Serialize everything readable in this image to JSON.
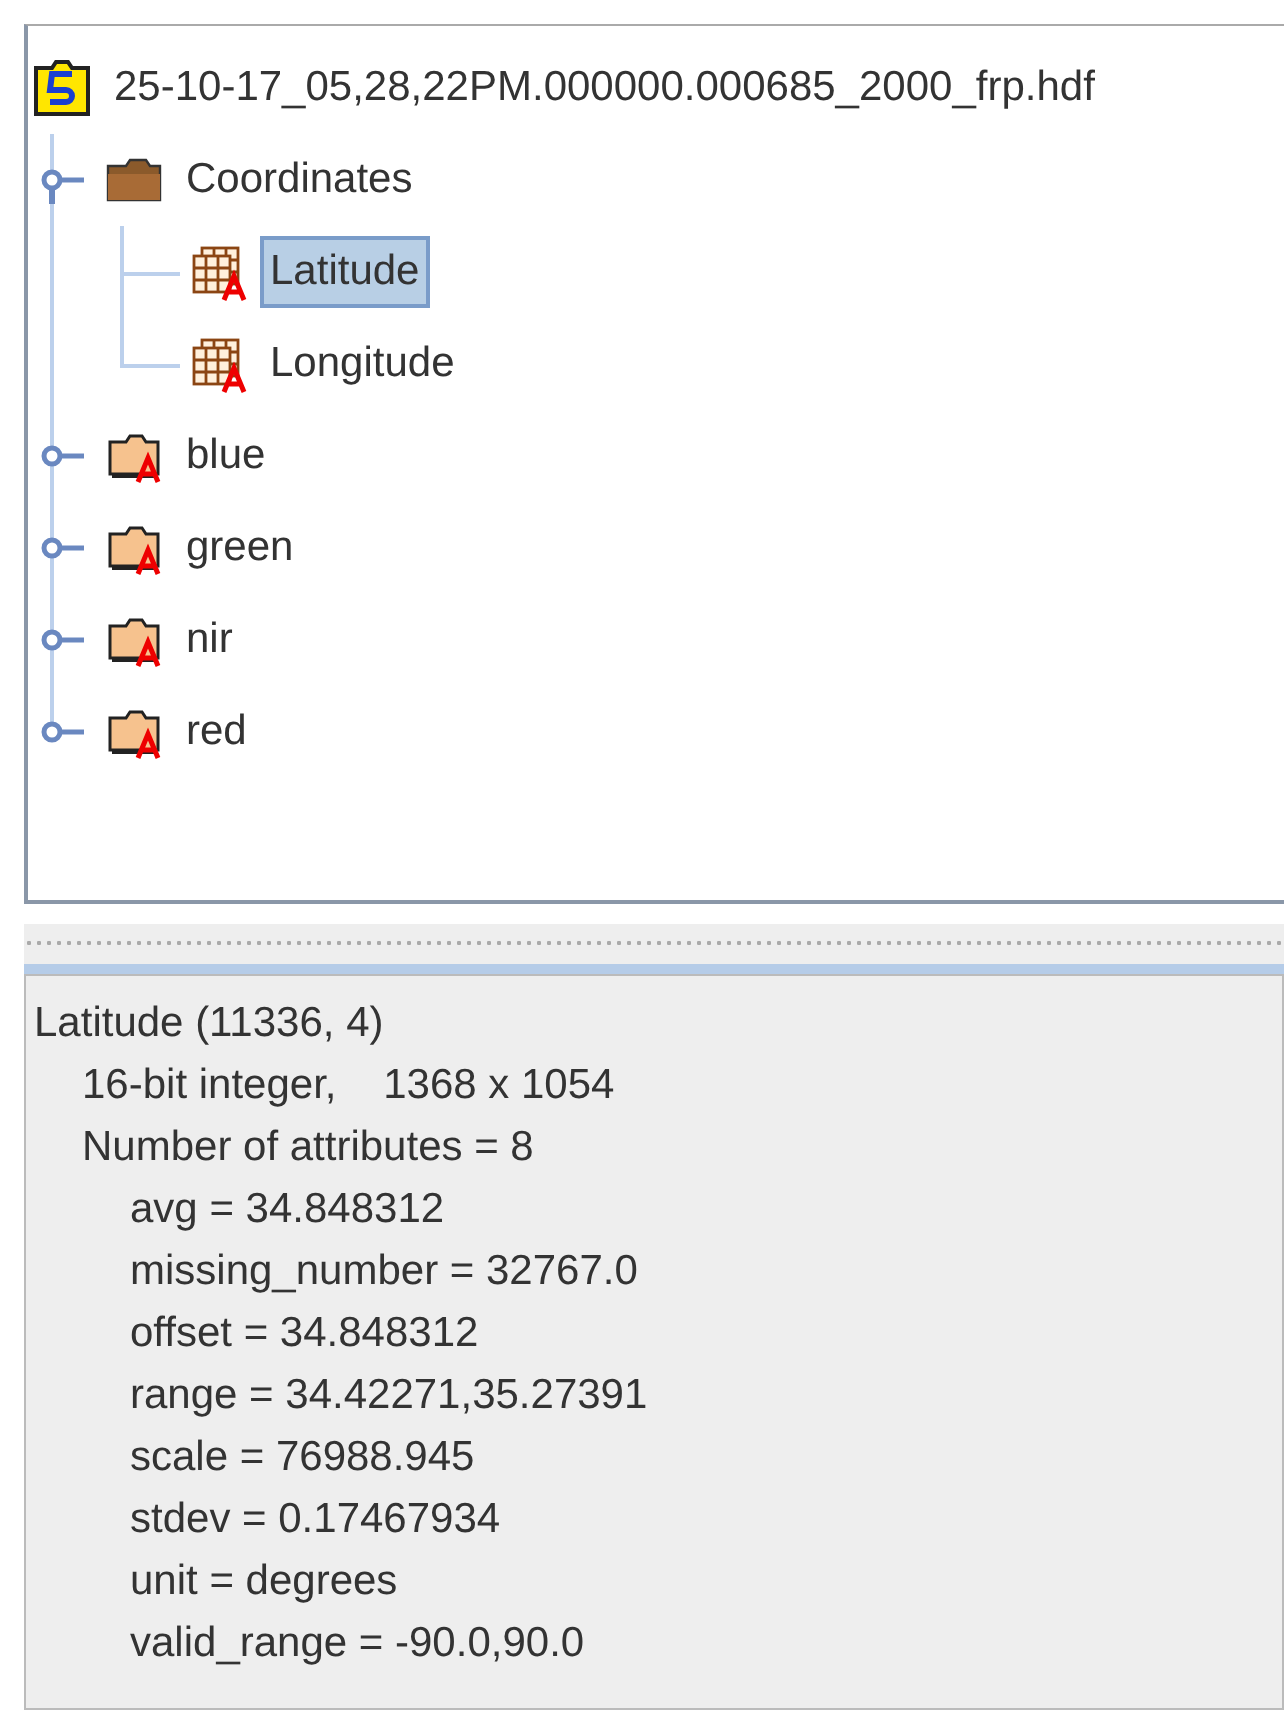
{
  "root": {
    "label": "25-10-17_05,28,22PM.000000.000685_2000_frp.hdf"
  },
  "tree": [
    {
      "label": "Coordinates",
      "kind": "group",
      "expanded": true,
      "children": [
        {
          "label": "Latitude",
          "kind": "dataset",
          "selected": true
        },
        {
          "label": "Longitude",
          "kind": "dataset",
          "selected": false
        }
      ]
    },
    {
      "label": "blue",
      "kind": "group_attr",
      "expanded": false
    },
    {
      "label": "green",
      "kind": "group_attr",
      "expanded": false
    },
    {
      "label": "nir",
      "kind": "group_attr",
      "expanded": false
    },
    {
      "label": "red",
      "kind": "group_attr",
      "expanded": false
    }
  ],
  "info": {
    "title": "Latitude (11336, 4)",
    "lines": [
      {
        "text": "16-bit integer,    1368 x 1054"
      },
      {
        "text": "Number of attributes = 8",
        "children": [
          {
            "text": "avg = 34.848312"
          },
          {
            "text": "missing_number = 32767.0"
          },
          {
            "text": "offset = 34.848312"
          },
          {
            "text": "range = 34.42271,35.27391"
          },
          {
            "text": "scale = 76988.945"
          },
          {
            "text": "stdev = 0.17467934"
          },
          {
            "text": "unit = degrees"
          },
          {
            "text": "valid_range = -90.0,90.0"
          }
        ]
      }
    ]
  }
}
